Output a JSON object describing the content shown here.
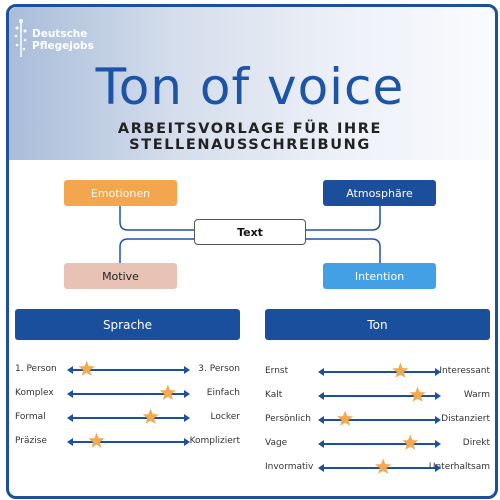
{
  "logo": {
    "line1": "Deutsche",
    "line2": "Pflegejobs"
  },
  "header": {
    "title": "Ton of voice",
    "subtitle": "ARBEITSVORLAGE FÜR IHRE STELLENAUSSCHREIBUNG"
  },
  "diagram": {
    "center": "Text",
    "nodes": [
      {
        "label": "Emotionen",
        "color": "#f4a64e",
        "text_color": "#ffffff"
      },
      {
        "label": "Atmosphäre",
        "color": "#1b4f9c",
        "text_color": "#ffffff"
      },
      {
        "label": "Motive",
        "color": "#e9c2b6",
        "text_color": "#222222"
      },
      {
        "label": "Intention",
        "color": "#43a0e4",
        "text_color": "#ffffff"
      }
    ],
    "line_color": "#1d54a6"
  },
  "sections": {
    "sprache": {
      "title": "Sprache",
      "scales": [
        {
          "left": "1. Person",
          "right": "3. Person",
          "value": 0.16
        },
        {
          "left": "Komplex",
          "right": "Einfach",
          "value": 0.82
        },
        {
          "left": "Formal",
          "right": "Locker",
          "value": 0.68
        },
        {
          "left": "Präzise",
          "right": "Kompliziert",
          "value": 0.24
        }
      ]
    },
    "ton": {
      "title": "Ton",
      "scales": [
        {
          "left": "Ernst",
          "right": "Interessant",
          "value": 0.67
        },
        {
          "left": "Kalt",
          "right": "Warm",
          "value": 0.81
        },
        {
          "left": "Persönlich",
          "right": "Distanziert",
          "value": 0.22
        },
        {
          "left": "Vage",
          "right": "Direkt",
          "value": 0.75
        },
        {
          "left": "Invormativ",
          "right": "Unterhaltsam",
          "value": 0.53
        }
      ]
    }
  },
  "colors": {
    "brand_blue": "#1c4f9e",
    "star": "#f5a94f"
  }
}
